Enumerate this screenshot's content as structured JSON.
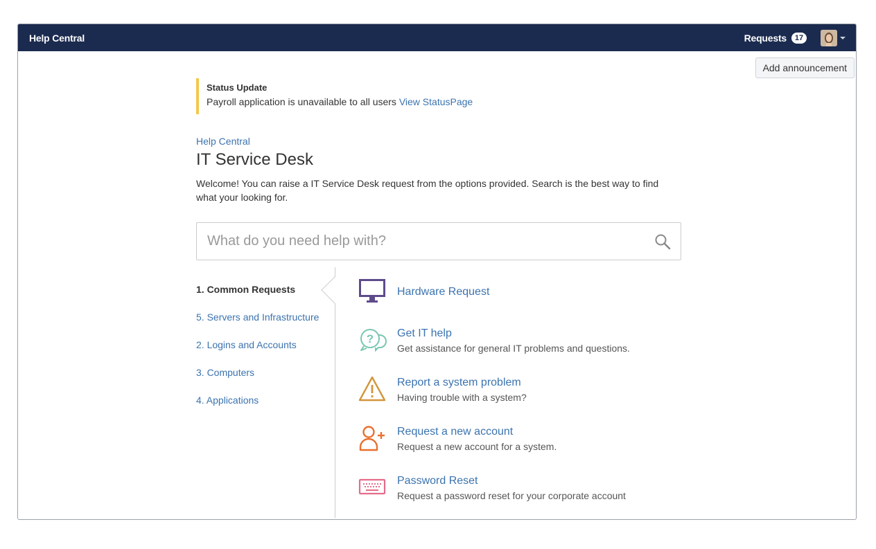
{
  "header": {
    "brand": "Help Central",
    "requests_label": "Requests",
    "requests_count": "17"
  },
  "toolbar": {
    "add_announcement": "Add announcement"
  },
  "status": {
    "title": "Status Update",
    "message": "Payroll application is unavailable to all users",
    "link": "View StatusPage"
  },
  "breadcrumb": "Help Central",
  "page_title": "IT Service Desk",
  "welcome": "Welcome! You can raise a IT Service Desk request from the options provided. Search is the best way to find what your looking for.",
  "search": {
    "placeholder": "What do you need help with?"
  },
  "groups": [
    {
      "label": "1. Common Requests",
      "active": true
    },
    {
      "label": "5. Servers and Infrastructure"
    },
    {
      "label": "2. Logins and Accounts"
    },
    {
      "label": "3. Computers"
    },
    {
      "label": "4. Applications"
    }
  ],
  "request_types": [
    {
      "title": "Hardware Request",
      "desc": "",
      "icon": "monitor-icon",
      "color": "#5e4b8b"
    },
    {
      "title": "Get IT help",
      "desc": "Get assistance for general IT problems and questions.",
      "icon": "question-bubbles-icon",
      "color": "#7ac7b0"
    },
    {
      "title": "Report a system problem",
      "desc": "Having trouble with a system?",
      "icon": "warning-triangle-icon",
      "color": "#d3953a"
    },
    {
      "title": "Request a new account",
      "desc": "Request a new account for a system.",
      "icon": "add-user-icon",
      "color": "#e9702e"
    },
    {
      "title": "Password Reset",
      "desc": "Request a password reset for your corporate account",
      "icon": "keyboard-icon",
      "color": "#e56b8a"
    }
  ],
  "colors": {
    "header_bg": "#1b2b4f",
    "link": "#3b73af",
    "status_border": "#f2c94c"
  }
}
